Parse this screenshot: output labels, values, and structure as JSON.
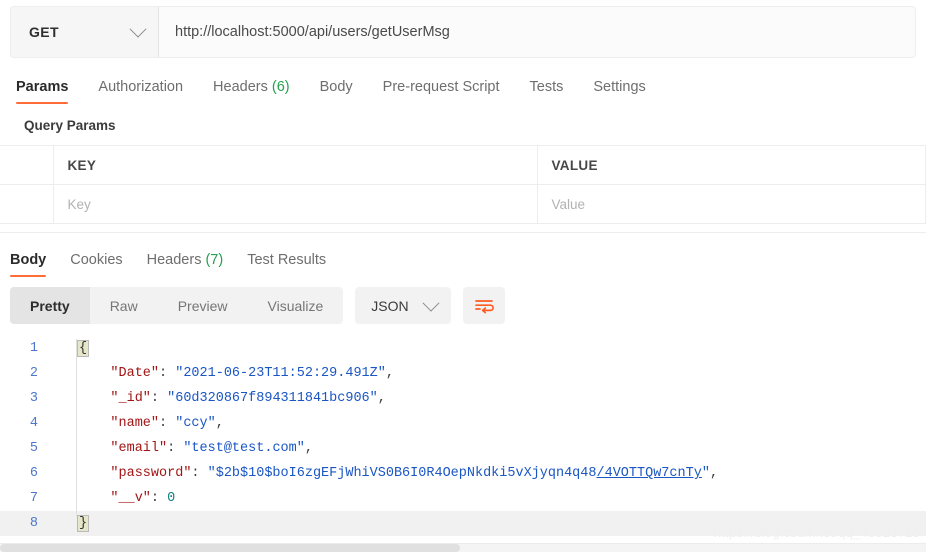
{
  "request": {
    "method": "GET",
    "url": "http://localhost:5000/api/users/getUserMsg",
    "tabs": [
      {
        "label": "Params",
        "count": "",
        "active": true
      },
      {
        "label": "Authorization",
        "count": "",
        "active": false
      },
      {
        "label": "Headers",
        "count": "(6)",
        "active": false
      },
      {
        "label": "Body",
        "count": "",
        "active": false
      },
      {
        "label": "Pre-request Script",
        "count": "",
        "active": false
      },
      {
        "label": "Tests",
        "count": "",
        "active": false
      },
      {
        "label": "Settings",
        "count": "",
        "active": false
      }
    ]
  },
  "query_params": {
    "title": "Query Params",
    "headers": {
      "key": "KEY",
      "value": "VALUE"
    },
    "rows": [
      {
        "key_placeholder": "Key",
        "value_placeholder": "Value"
      }
    ]
  },
  "response": {
    "tabs": [
      {
        "label": "Body",
        "count": "",
        "active": true
      },
      {
        "label": "Cookies",
        "count": "",
        "active": false
      },
      {
        "label": "Headers",
        "count": "(7)",
        "active": false
      },
      {
        "label": "Test Results",
        "count": "",
        "active": false
      }
    ],
    "view_modes": [
      {
        "label": "Pretty",
        "active": true
      },
      {
        "label": "Raw",
        "active": false
      },
      {
        "label": "Preview",
        "active": false
      },
      {
        "label": "Visualize",
        "active": false
      }
    ],
    "format": "JSON",
    "wrap_icon": "word-wrap-icon",
    "body_lines": [
      {
        "n": "1",
        "segments": [
          {
            "t": "{",
            "c": "brace"
          }
        ]
      },
      {
        "n": "2",
        "segments": [
          {
            "t": "    ",
            "c": "p"
          },
          {
            "t": "\"Date\"",
            "c": "k"
          },
          {
            "t": ": ",
            "c": "p"
          },
          {
            "t": "\"2021-06-23T11:52:29.491Z\"",
            "c": "s"
          },
          {
            "t": ",",
            "c": "p"
          }
        ]
      },
      {
        "n": "3",
        "segments": [
          {
            "t": "    ",
            "c": "p"
          },
          {
            "t": "\"_id\"",
            "c": "k"
          },
          {
            "t": ": ",
            "c": "p"
          },
          {
            "t": "\"60d320867f894311841bc906\"",
            "c": "s"
          },
          {
            "t": ",",
            "c": "p"
          }
        ]
      },
      {
        "n": "4",
        "segments": [
          {
            "t": "    ",
            "c": "p"
          },
          {
            "t": "\"name\"",
            "c": "k"
          },
          {
            "t": ": ",
            "c": "p"
          },
          {
            "t": "\"ccy\"",
            "c": "s"
          },
          {
            "t": ",",
            "c": "p"
          }
        ]
      },
      {
        "n": "5",
        "segments": [
          {
            "t": "    ",
            "c": "p"
          },
          {
            "t": "\"email\"",
            "c": "k"
          },
          {
            "t": ": ",
            "c": "p"
          },
          {
            "t": "\"test@test.com\"",
            "c": "s"
          },
          {
            "t": ",",
            "c": "p"
          }
        ]
      },
      {
        "n": "6",
        "segments": [
          {
            "t": "    ",
            "c": "p"
          },
          {
            "t": "\"password\"",
            "c": "k"
          },
          {
            "t": ": ",
            "c": "p"
          },
          {
            "t": "\"$2b$10$boI6zgEFjWhiVS0B6I0R4OepNkdki5vXjyqn4q48",
            "c": "s"
          },
          {
            "t": "/4VOTTQw7cnTy",
            "c": "s lnk"
          },
          {
            "t": "\"",
            "c": "s"
          },
          {
            "t": ",",
            "c": "p"
          }
        ]
      },
      {
        "n": "7",
        "segments": [
          {
            "t": "    ",
            "c": "p"
          },
          {
            "t": "\"__v\"",
            "c": "k"
          },
          {
            "t": ": ",
            "c": "p"
          },
          {
            "t": "0",
            "c": "n"
          }
        ]
      },
      {
        "n": "8",
        "segments": [
          {
            "t": "}",
            "c": "brace"
          }
        ]
      }
    ]
  },
  "watermark": "https://blog.csdn.net/qq_43523725"
}
